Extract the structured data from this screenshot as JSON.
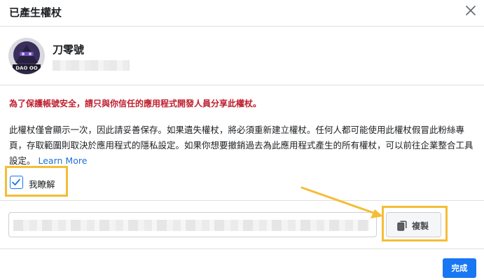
{
  "dialog": {
    "title": "已產生權杖",
    "close_icon": "close-icon"
  },
  "page": {
    "name": "刀零號",
    "avatar_text": "DAO OO",
    "subtitle_blurred": true
  },
  "warning": "為了保護帳號安全，請只與你信任的應用程式開發人員分享此權杖。",
  "description": {
    "text": "此權杖僅會顯示一次，因此請妥善保存。如果遺失權杖，將必須重新建立權杖。任何人都可能使用此權杖假冒此粉絲專頁，存取範圍則取決於應用程式的隱私設定。如果你想要撤銷過去為此應用程式產生的所有權杖，可以前往企業整合工具設定。",
    "link": "Learn More"
  },
  "acknowledge": {
    "label": "我瞭解",
    "checked": true
  },
  "token": {
    "value_blurred": true
  },
  "copy_button": {
    "label": "複製",
    "icon": "copy-icon"
  },
  "done_button": {
    "label": "完成"
  },
  "colors": {
    "accent": "#1877f2",
    "warning": "#be1e2d",
    "highlight": "#f5bd36",
    "link": "#216fdb"
  }
}
